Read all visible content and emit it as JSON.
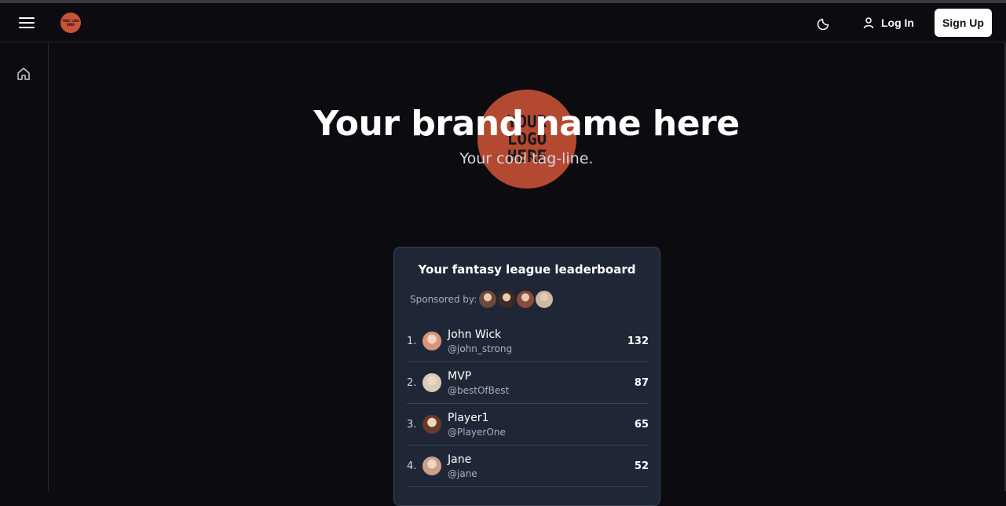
{
  "navbar": {
    "logo_text": "YOUR LOGO HERE",
    "login_label": "Log In",
    "signup_label": "Sign Up"
  },
  "hero": {
    "logo_text": "YOUR\nLOGO\nHERE",
    "brand_name": "Your brand name here",
    "tagline": "Your cool tag-line."
  },
  "leaderboard": {
    "title": "Your fantasy league leaderboard",
    "sponsored_label": "Sponsored by:",
    "sponsors": [
      {
        "color": "#6b4a3a"
      },
      {
        "color": "#3d2b24"
      },
      {
        "color": "#8a4a3c"
      },
      {
        "color": "#c9b9a6"
      }
    ],
    "players": [
      {
        "rank": "1.",
        "name": "John Wick",
        "handle": "@john_strong",
        "score": "132",
        "avatar_color": "#d9957a"
      },
      {
        "rank": "2.",
        "name": "MVP",
        "handle": "@bestOfBest",
        "score": "87",
        "avatar_color": "#d8cbb9"
      },
      {
        "rank": "3.",
        "name": "Player1",
        "handle": "@PlayerOne",
        "score": "65",
        "avatar_color": "#6a3a22"
      },
      {
        "rank": "4.",
        "name": "Jane",
        "handle": "@jane",
        "score": "52",
        "avatar_color": "#c9a08c"
      }
    ]
  },
  "colors": {
    "background": "#0b0b10",
    "card": "#1f2736",
    "logo": "#c24f34"
  },
  "icons": {
    "menu": "hamburger-icon",
    "theme": "moon-icon",
    "login": "user-icon",
    "home": "home-icon"
  }
}
